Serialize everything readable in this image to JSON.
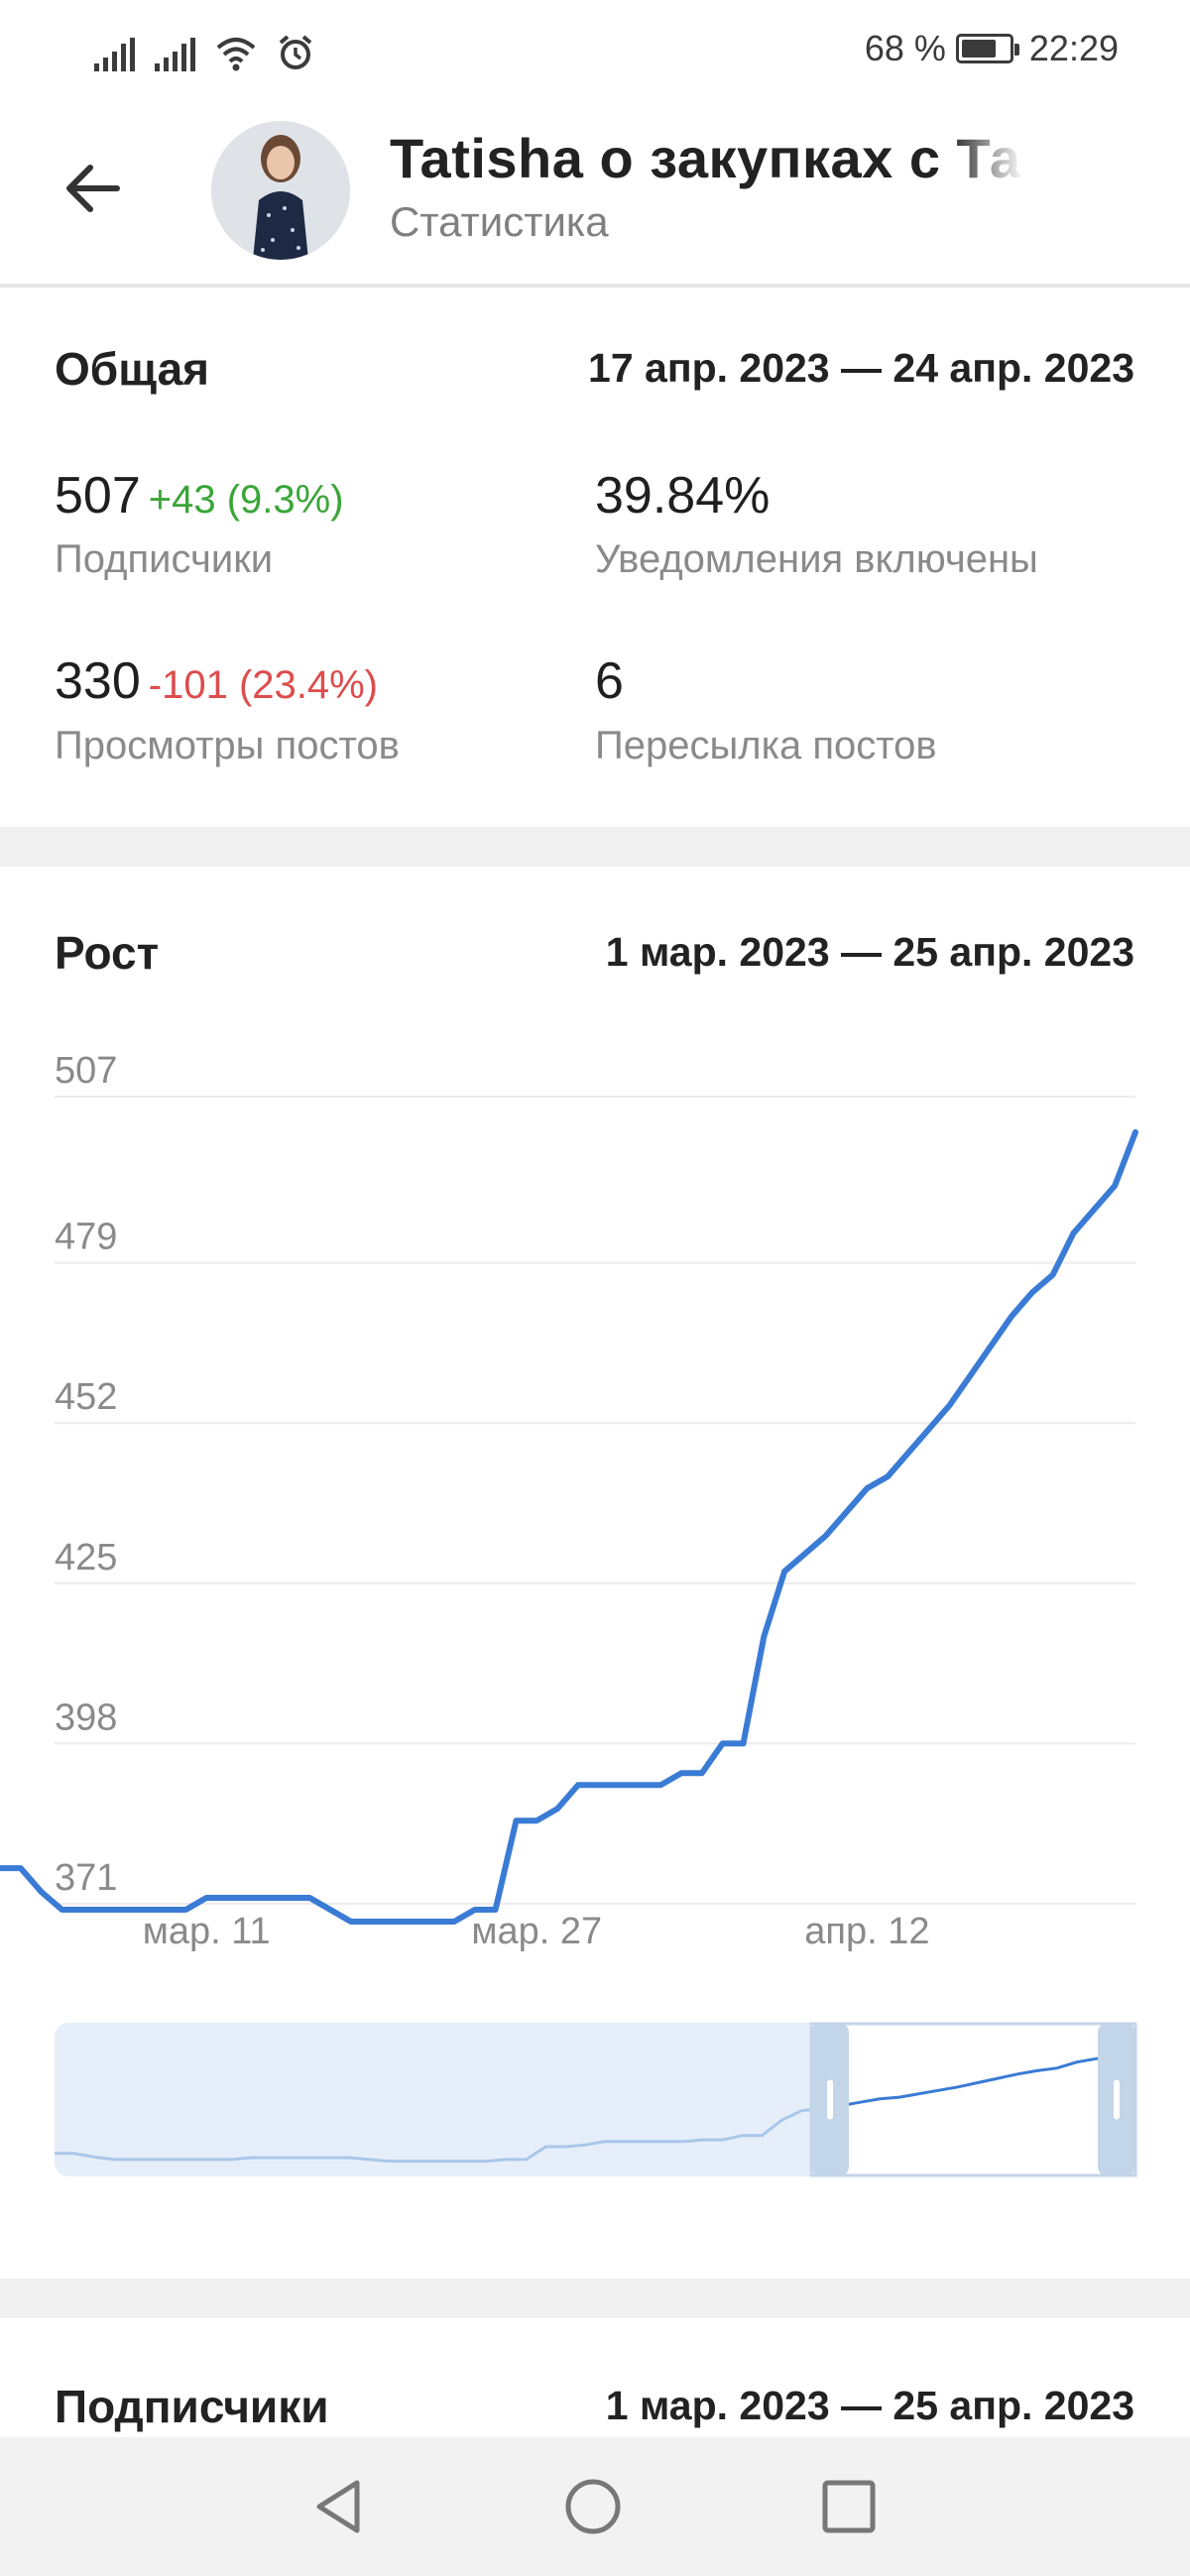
{
  "status_bar": {
    "battery": "68 %",
    "time": "22:29"
  },
  "header": {
    "title": "Tatisha о закупках с Та",
    "subtitle": "Статистика"
  },
  "overview": {
    "title": "Общая",
    "range": "17 апр. 2023 — 24 апр. 2023",
    "stats": [
      {
        "value": "507",
        "delta": "+43 (9.3%)",
        "delta_type": "positive",
        "label": "Подписчики"
      },
      {
        "value": "39.84%",
        "delta": "",
        "label": "Уведомления включены"
      },
      {
        "value": "330",
        "delta": "-101 (23.4%)",
        "delta_type": "negative",
        "label": "Просмотры постов"
      },
      {
        "value": "6",
        "delta": "",
        "label": "Пересылка постов"
      }
    ]
  },
  "growth": {
    "title": "Рост",
    "range": "1 мар. 2023 — 25 апр. 2023"
  },
  "chart_data": {
    "type": "line",
    "title": "Рост",
    "y_ticks": [
      "507",
      "479",
      "452",
      "425",
      "398",
      "371"
    ],
    "x_ticks": [
      "мар. 11",
      "мар. 27",
      "апр. 12"
    ],
    "ylim": [
      371,
      507
    ],
    "grid": true,
    "line_color": "#3a7bd5",
    "series": [
      {
        "x": [
          "мар. 1",
          "мар. 2",
          "мар. 3",
          "мар. 4",
          "мар. 5",
          "мар. 6",
          "мар. 7",
          "мар. 8",
          "мар. 9",
          "мар. 10",
          "мар. 11",
          "мар. 12",
          "мар. 13",
          "мар. 14",
          "мар. 15",
          "мар. 16",
          "мар. 17",
          "мар. 18",
          "мар. 19",
          "мар. 20",
          "мар. 21",
          "мар. 22",
          "мар. 23",
          "мар. 24",
          "мар. 25",
          "мар. 26",
          "мар. 27",
          "мар. 28",
          "мар. 29",
          "мар. 30",
          "мар. 31",
          "апр. 1",
          "апр. 2",
          "апр. 3",
          "апр. 4",
          "апр. 5",
          "апр. 6",
          "апр. 7",
          "апр. 8",
          "апр. 9",
          "апр. 10",
          "апр. 11",
          "апр. 12",
          "апр. 13",
          "апр. 14",
          "апр. 15",
          "апр. 16",
          "апр. 17",
          "апр. 18",
          "апр. 19",
          "апр. 20",
          "апр. 21",
          "апр. 22",
          "апр. 23",
          "апр. 24",
          "апр. 25"
        ],
        "values": [
          377,
          377,
          373,
          370,
          370,
          370,
          370,
          370,
          370,
          370,
          372,
          372,
          372,
          372,
          372,
          372,
          370,
          368,
          368,
          368,
          368,
          368,
          368,
          370,
          370,
          385,
          385,
          387,
          391,
          391,
          391,
          391,
          391,
          393,
          393,
          398,
          398,
          416,
          427,
          430,
          433,
          437,
          441,
          443,
          447,
          451,
          455,
          460,
          465,
          470,
          474,
          477,
          484,
          488,
          492,
          501
        ]
      }
    ],
    "navigator": {
      "range": "1 мар. 2023 — 25 апр. 2023",
      "selected_fraction": [
        0.7,
        1.0
      ]
    }
  },
  "subscribers": {
    "title": "Подписчики",
    "range": "1 мар. 2023 — 25 апр. 2023"
  },
  "navbar": {
    "items": [
      "back",
      "home",
      "recents"
    ]
  }
}
